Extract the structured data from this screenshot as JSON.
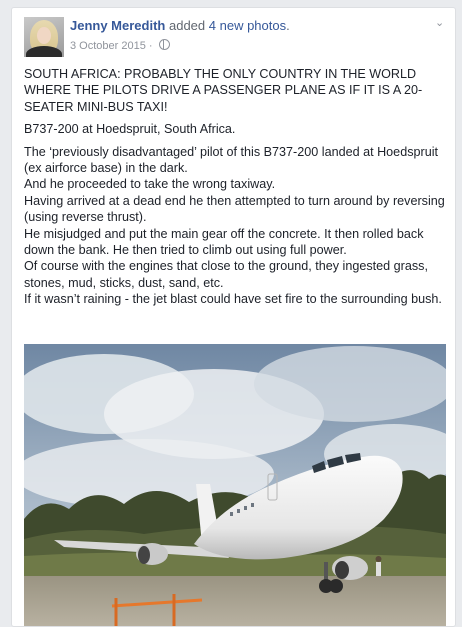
{
  "post": {
    "author": "Jenny Meredith",
    "action_prefix": "added",
    "action_link": "4 new photos",
    "action_suffix": ".",
    "date": "3 October 2015",
    "separator": "·",
    "privacy_icon": "globe-icon",
    "menu_icon": "chevron-down-icon",
    "headline": "SOUTH AFRICA: PROBABLY THE ONLY COUNTRY IN THE WORLD WHERE THE PILOTS DRIVE A PASSENGER PLANE AS IF IT IS A 20-SEATER MINI-BUS TAXI!",
    "subtitle": "B737-200 at Hoedspruit, South Africa.",
    "lines": [
      "The ‘previously disadvantaged’ pilot of this B737-200 landed at Hoedspruit (ex airforce base) in the dark.",
      "And he proceeded to take the wrong taxiway.",
      "Having arrived at a dead end he then attempted to turn around by reversing (using reverse thrust).",
      "He misjudged and put the main gear off the concrete. It then rolled back down the bank. He then tried to climb out using full power.",
      "Of course with the engines that close to the ground, they ingested grass, stones, mud, sticks, dust, sand, etc.",
      "If it wasn’t raining - the jet blast could have set fire to the surrounding bush."
    ]
  },
  "colors": {
    "link": "#365899",
    "text": "#1d2129",
    "meta": "#90949c",
    "background": "#e9ebee"
  }
}
